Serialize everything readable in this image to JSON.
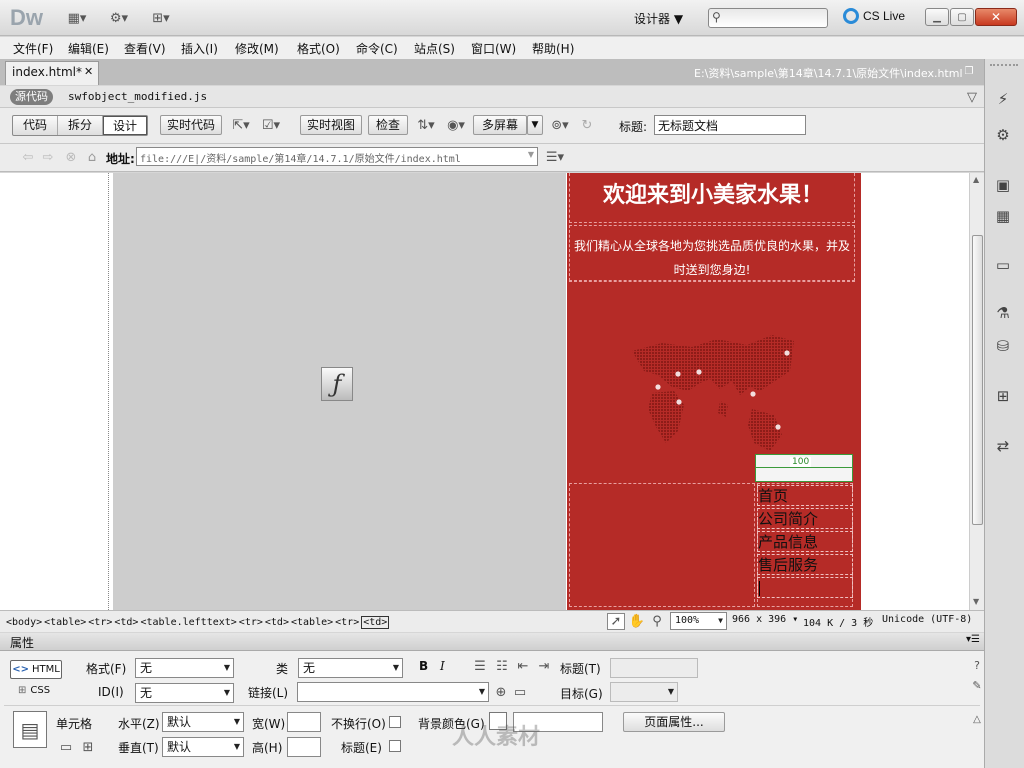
{
  "app": {
    "logo": "Dw",
    "workspace": "设计器",
    "search_placeholder": "",
    "cslive": "CS Live",
    "icons": [
      "layout-icon",
      "gear-icon",
      "site-icon",
      "search-icon",
      "cslive-icon",
      "minimize-icon",
      "maximize-icon",
      "close-icon"
    ]
  },
  "menu": [
    "文件(F)",
    "编辑(E)",
    "查看(V)",
    "插入(I)",
    "修改(M)",
    "格式(O)",
    "命令(C)",
    "站点(S)",
    "窗口(W)",
    "帮助(H)"
  ],
  "doc": {
    "tab": "index.html*",
    "path": "E:\\资料\\sample\\第14章\\14.7.1\\原始文件\\index.html",
    "source_label": "源代码",
    "related_file": "swfobject_modified.js"
  },
  "toolbar": {
    "code": "代码",
    "split": "拆分",
    "design": "设计",
    "live_code": "实时代码",
    "live_view": "实时视图",
    "inspect": "检查",
    "multiscreen": "多屏幕",
    "title_label": "标题:",
    "title_value": "无标题文档"
  },
  "address": {
    "label": "地址:",
    "url": "file:///E|/资料/sample/第14章/14.7.1/原始文件/index.html"
  },
  "page": {
    "heading": "欢迎来到小美家水果！",
    "intro": "我们精心从全球各地为您挑选品质优良的水果，并及时送到您身边!",
    "width_indicator": "100",
    "nav": [
      "首页",
      "公司简介",
      "产品信息",
      "售后服务"
    ],
    "accent_color": "#b52b27"
  },
  "status": {
    "tags": [
      "<body>",
      "<table>",
      "<tr>",
      "<td>",
      "<table.lefttext>",
      "<tr>",
      "<td>",
      "<table>",
      "<tr>",
      "<td>"
    ],
    "zoom": "100%",
    "size": "966 x 396",
    "download": "104 K / 3 秒",
    "encoding": "Unicode (UTF-8)"
  },
  "properties": {
    "title": "属性",
    "html_btn": "HTML",
    "css_btn": "CSS",
    "format_label": "格式(F)",
    "format_value": "无",
    "class_label": "类",
    "class_value": "无",
    "id_label": "ID(I)",
    "id_value": "无",
    "link_label": "链接(L)",
    "title_label": "标题(T)",
    "target_label": "目标(G)",
    "bold": "B",
    "italic": "I",
    "cell_label": "单元格",
    "horz_label": "水平(Z)",
    "horz_value": "默认",
    "vert_label": "垂直(T)",
    "vert_value": "默认",
    "width_label": "宽(W)",
    "height_label": "高(H)",
    "nowrap_label": "不换行(O)",
    "header_label": "标题(E)",
    "bg_label": "背景颜色(G)",
    "page_props": "页面属性...",
    "watermark": "人人素材"
  }
}
